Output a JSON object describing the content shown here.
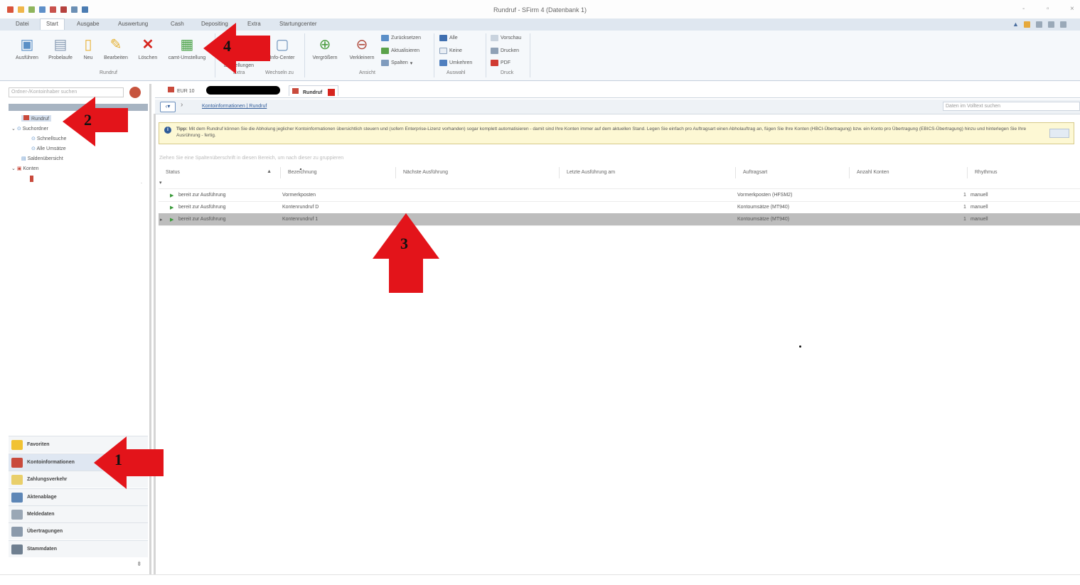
{
  "window": {
    "title": "Rundruf - SFirm 4 (Datenbank 1)",
    "controls": [
      "-",
      "▫",
      "×"
    ]
  },
  "menu": {
    "tabs": [
      "Datei",
      "Start",
      "Ausgabe",
      "Auswertung",
      "Cash",
      "Depositing",
      "Extra",
      "Startungcenter"
    ],
    "active_index": 1
  },
  "ribbon": {
    "groups": [
      {
        "label": "Rundruf",
        "buttons": [
          "Ausführen",
          "Probelaufe",
          "Neu",
          "Bearbeiten",
          "Löschen",
          "camt-Umstellung"
        ]
      },
      {
        "label": "Extra",
        "buttons": [
          "Vergrößern",
          "Verkleinern"
        ]
      },
      {
        "label": "Wechseln zu",
        "buttons": [
          "Info-Center"
        ]
      },
      {
        "label": "Ansicht",
        "buttons": [
          "Zurücksetzen",
          "Aktualisieren",
          "Spalten"
        ]
      },
      {
        "label": "Auswahl",
        "buttons": [
          "Alle",
          "Keine",
          "Umkehren"
        ]
      },
      {
        "label": "Druck",
        "buttons": [
          "Vorschau",
          "Drucken",
          "PDF"
        ]
      }
    ],
    "extra_label": "Einstellungen"
  },
  "sidebar": {
    "search_placeholder": "Ordner-/Kontoinhaber suchen",
    "tree": [
      "Rundruf",
      "Suchordner",
      "Schnellsuche",
      "Alle Umsätze",
      "Saldenübersicht",
      "Konten"
    ],
    "nav_items": [
      "Favoriten",
      "Kontoinformationen",
      "Zahlungsverkehr",
      "Aktenablage",
      "Meldedaten",
      "Übertragungen",
      "Stammdaten"
    ]
  },
  "doc_tabs": [
    "EUR 10",
    "Rundruf"
  ],
  "breadcrumb": "Kontoinformationen | Rundruf",
  "fulltext_search": "Daten im Volltext suchen",
  "tip": {
    "label": "Tipp:",
    "text": "Mit dem Rundruf können Sie die Abholung jeglicher Kontoinformationen übersichtlich steuern und (sofern Enterprise-Lizenz vorhanden) sogar komplett automatisieren - damit sind Ihre Konten immer auf dem aktuellen Stand. Legen Sie einfach pro Auftragsart einen Abholauftrag an, fügen Sie Ihre Konten (HBCI-Übertragung) bzw. ein Konto pro Übertragung (EBICS-Übertragung) hinzu und hinterlegen Sie Ihre Ausrührung - fertig."
  },
  "group_hint": "Ziehen Sie eine Spaltenüberschrift in diesen Bereich, um nach dieser zu gruppieren",
  "table": {
    "columns": [
      "Status",
      "Bezeichnung",
      "Nächste Ausführung",
      "Letzte Ausführung am",
      "Auftragsart",
      "Anzahl Konten",
      "Rhythmus"
    ],
    "rows": [
      [
        "bereit zur Ausführung",
        "Vormerkposten",
        "",
        "",
        "Vormerkposten (HFSM2)",
        "1",
        "manuell"
      ],
      [
        "bereit zur Ausführung",
        "Kontenrundruf D",
        "",
        "",
        "Kontoumsätze (MT940)",
        "1",
        "manuell"
      ],
      [
        "bereit zur Ausführung",
        "Kontenrundruf 1",
        "",
        "",
        "Kontoumsätze (MT940)",
        "1",
        "manuell"
      ]
    ],
    "selected_row": 2
  },
  "callouts": [
    "1",
    "2",
    "3",
    "4"
  ],
  "colors": {
    "arrow": "#e3141a",
    "ribbon_bg": "#f5f8fb",
    "tip_bg": "#fdf8d4",
    "selected_row": "#bdbdbd"
  }
}
